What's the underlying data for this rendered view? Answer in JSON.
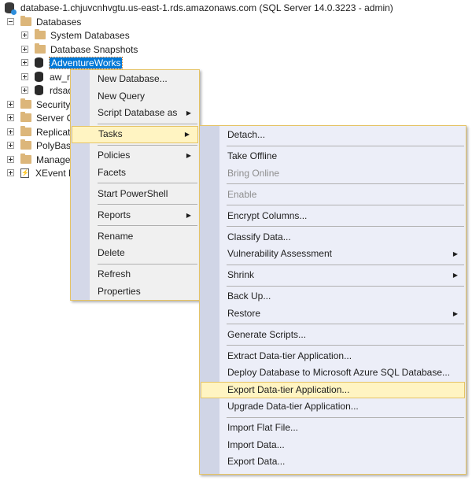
{
  "tree": {
    "server": "database-1.chjuvcnhvgtu.us-east-1.rds.amazonaws.com (SQL Server 14.0.3223 - admin)",
    "databases": "Databases",
    "system_databases": "System Databases",
    "database_snapshots": "Database Snapshots",
    "adventureworks": "AdventureWorks",
    "aw": "aw_n",
    "rdsadmin": "rdsad",
    "security": "Security",
    "server_objects": "Server Ob",
    "replication": "Replicatio",
    "polybase": "PolyBase",
    "management": "Manager",
    "xevent": "XEvent Pr"
  },
  "context_menu": {
    "new_database": "New Database...",
    "new_query": "New Query",
    "script_database_as": "Script Database as",
    "tasks": "Tasks",
    "policies": "Policies",
    "facets": "Facets",
    "start_powershell": "Start PowerShell",
    "reports": "Reports",
    "rename": "Rename",
    "delete": "Delete",
    "refresh": "Refresh",
    "properties": "Properties"
  },
  "tasks_menu": {
    "detach": "Detach...",
    "take_offline": "Take Offline",
    "bring_online": "Bring Online",
    "enable": "Enable",
    "encrypt_columns": "Encrypt Columns...",
    "classify_data": "Classify Data...",
    "vulnerability_assessment": "Vulnerability Assessment",
    "shrink": "Shrink",
    "back_up": "Back Up...",
    "restore": "Restore",
    "generate_scripts": "Generate Scripts...",
    "extract_dac": "Extract Data-tier Application...",
    "deploy_azure": "Deploy Database to Microsoft Azure SQL Database...",
    "export_dac": "Export Data-tier Application...",
    "upgrade_dac": "Upgrade Data-tier Application...",
    "import_flat_file": "Import Flat File...",
    "import_data": "Import Data...",
    "export_data": "Export Data..."
  },
  "submenu_arrow": "▶"
}
